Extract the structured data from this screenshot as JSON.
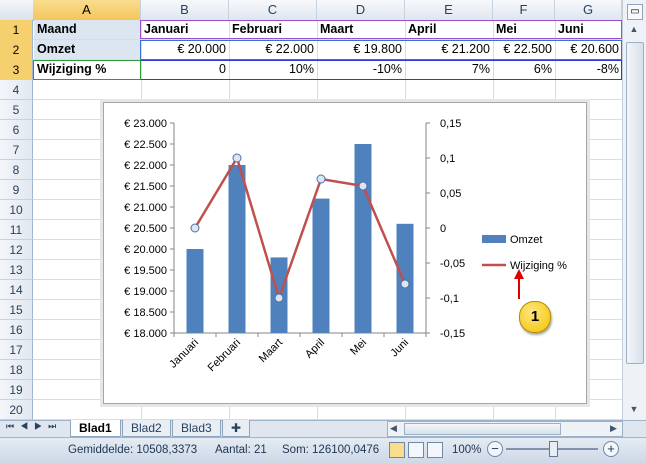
{
  "columns": [
    "A",
    "B",
    "C",
    "D",
    "E",
    "F",
    "G"
  ],
  "rows": [
    "1",
    "2",
    "3",
    "4",
    "5",
    "6",
    "7",
    "8",
    "9",
    "10",
    "11",
    "12",
    "13",
    "14",
    "15",
    "16",
    "17",
    "18",
    "19",
    "20"
  ],
  "cells": {
    "r1": [
      "Maand",
      "Januari",
      "Februari",
      "Maart",
      "April",
      "Mei",
      "Juni"
    ],
    "r2": [
      "Omzet",
      "€ 20.000",
      "€ 22.000",
      "€ 19.800",
      "€ 21.200",
      "€ 22.500",
      "€ 20.600"
    ],
    "r3": [
      "Wijziging %",
      "0",
      "10%",
      "-10%",
      "7%",
      "6%",
      "-8%"
    ]
  },
  "chart_data": {
    "type": "bar",
    "categories": [
      "Januari",
      "Februari",
      "Maart",
      "April",
      "Mei",
      "Juni"
    ],
    "series": [
      {
        "name": "Omzet",
        "type": "bar",
        "axis": "left",
        "values": [
          20000,
          22000,
          19800,
          21200,
          22500,
          20600
        ],
        "color": "#4f81bd"
      },
      {
        "name": "Wijziging %",
        "type": "line",
        "axis": "right",
        "values": [
          0,
          0.1,
          -0.1,
          0.07,
          0.06,
          -0.08
        ],
        "color": "#c0504d"
      }
    ],
    "ylim": [
      18000,
      23000
    ],
    "y2lim": [
      -0.15,
      0.15
    ],
    "left_ticks": [
      "€ 18.000",
      "€ 18.500",
      "€ 19.000",
      "€ 19.500",
      "€ 20.000",
      "€ 20.500",
      "€ 21.000",
      "€ 21.500",
      "€ 22.000",
      "€ 22.500",
      "€ 23.000"
    ],
    "right_ticks": [
      "-0,15",
      "-0,1",
      "-0,05",
      "0",
      "0,05",
      "0,1",
      "0,15"
    ],
    "legend_position": "right"
  },
  "callout": {
    "number": "1"
  },
  "sheets": [
    "Blad1",
    "Blad2",
    "Blad3"
  ],
  "active_sheet": "Blad1",
  "status": {
    "average": "Gemiddelde: 10508,3373",
    "count": "Aantal: 21",
    "sum": "Som: 126100,0476",
    "zoom": "100%"
  },
  "colors": {
    "accent": "#4f81bd",
    "line": "#c0504d",
    "callout": "#f2c200"
  }
}
